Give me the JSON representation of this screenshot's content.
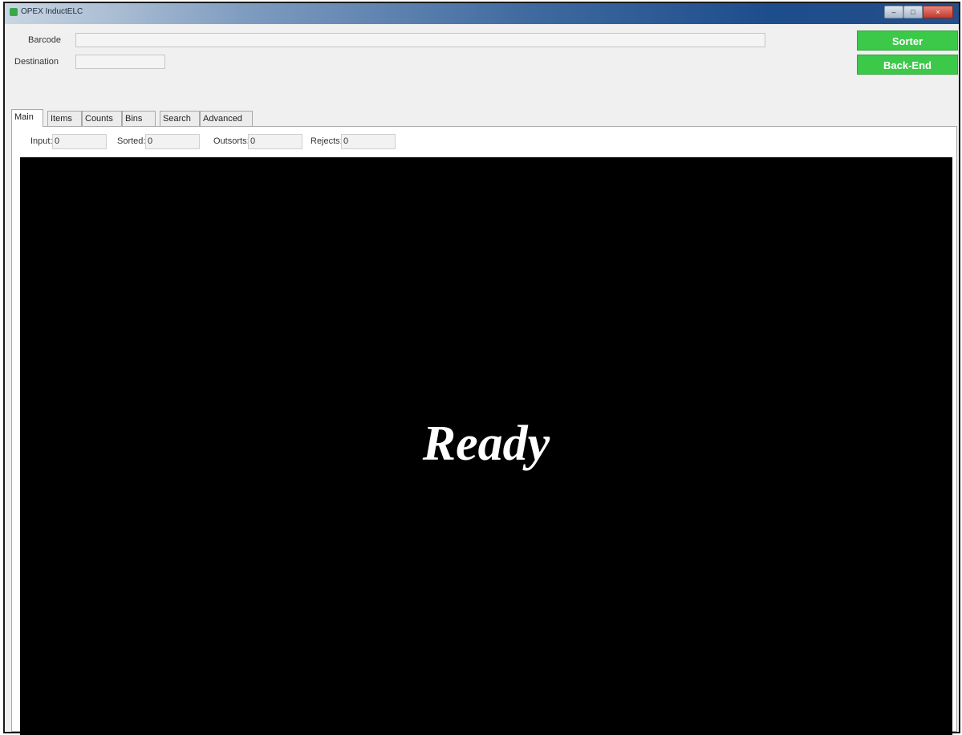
{
  "window": {
    "title": "OPEX InductELC",
    "controls": {
      "minimize": "–",
      "maximize": "□",
      "close": "×"
    }
  },
  "header": {
    "barcode_label": "Barcode",
    "barcode_value": "",
    "destination_label": "Destination",
    "destination_value": "",
    "sorter_button": "Sorter",
    "backend_button": "Back-End",
    "button_color": "#3cc94a"
  },
  "tabs": [
    {
      "label": "Main",
      "active": true
    },
    {
      "label": "Items",
      "active": false
    },
    {
      "label": "Counts",
      "active": false
    },
    {
      "label": "Bins",
      "active": false
    },
    {
      "label": "Search",
      "active": false
    },
    {
      "label": "Advanced",
      "active": false
    }
  ],
  "main": {
    "counters": [
      {
        "label": "Input:",
        "value": "0"
      },
      {
        "label": "Sorted:",
        "value": "0"
      },
      {
        "label": "Outsorts:",
        "value": "0"
      },
      {
        "label": "Rejects:",
        "value": "0"
      }
    ],
    "status_text": "Ready",
    "display_background": "#000000",
    "status_color": "#ffffff"
  }
}
